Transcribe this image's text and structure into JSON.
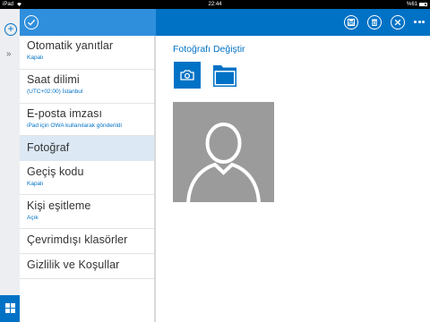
{
  "status_bar": {
    "carrier": "iPad",
    "time": "22:44",
    "battery": "%61"
  },
  "rail": {
    "add_icon": "plus-circle-icon",
    "expand_icon": "double-chevron-right-icon",
    "apps_icon": "app-grid-icon"
  },
  "header": {
    "left_icon": "check-circle-icon",
    "actions": [
      "save-icon",
      "delete-icon",
      "close-icon",
      "more-icon"
    ]
  },
  "settings": {
    "items": [
      {
        "label": "Otomatik yanıtlar",
        "sub": "Kapalı"
      },
      {
        "label": "Saat dilimi",
        "sub": "(UTC+02:00) İstanbul"
      },
      {
        "label": "E-posta imzası",
        "sub": "iPad için OWA kullanılarak gönderildi"
      },
      {
        "label": "Fotoğraf",
        "sub": ""
      },
      {
        "label": "Geçiş kodu",
        "sub": "Kapalı"
      },
      {
        "label": "Kişi eşitleme",
        "sub": "Açık"
      },
      {
        "label": "Çevrimdışı klasörler",
        "sub": ""
      },
      {
        "label": "Gizlilik ve Koşullar",
        "sub": ""
      }
    ],
    "selected_index": 3
  },
  "content": {
    "title": "Fotoğrafı Değiştir",
    "camera_icon": "camera-icon",
    "folder_icon": "folder-icon",
    "avatar_icon": "default-person-icon"
  },
  "colors": {
    "accent": "#0072c6",
    "header_left": "#2f8fdc",
    "selected_bg": "#dce9f5",
    "avatar_bg": "#9b9b9b"
  }
}
